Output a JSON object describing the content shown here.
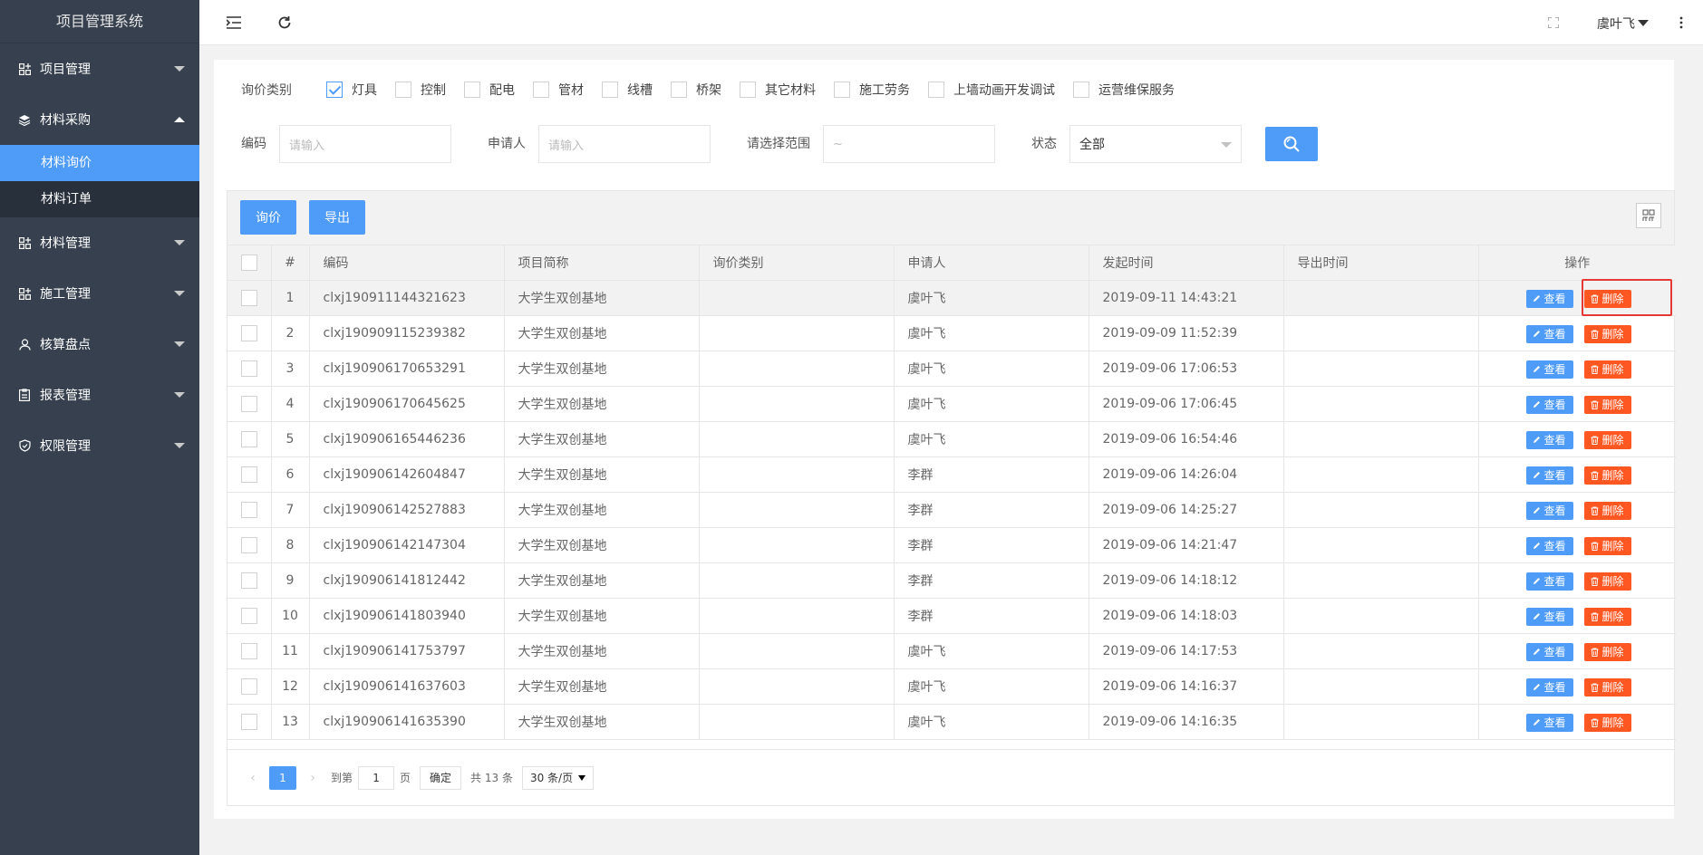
{
  "app": {
    "title": "项目管理系统"
  },
  "sidebar": {
    "items": [
      {
        "label": "项目管理",
        "icon": "grid-plus-icon",
        "expanded": false
      },
      {
        "label": "材料采购",
        "icon": "layers-icon",
        "expanded": true,
        "children": [
          {
            "label": "材料询价",
            "active": true
          },
          {
            "label": "材料订单",
            "active": false
          }
        ]
      },
      {
        "label": "材料管理",
        "icon": "grid-plus-icon",
        "expanded": false
      },
      {
        "label": "施工管理",
        "icon": "grid-plus-icon",
        "expanded": false
      },
      {
        "label": "核算盘点",
        "icon": "user-icon",
        "expanded": false
      },
      {
        "label": "报表管理",
        "icon": "clipboard-icon",
        "expanded": false
      },
      {
        "label": "权限管理",
        "icon": "shield-icon",
        "expanded": false
      }
    ]
  },
  "header": {
    "user": "虞叶飞"
  },
  "filters": {
    "category_label": "询价类别",
    "categories": [
      {
        "label": "灯具",
        "checked": true
      },
      {
        "label": "控制",
        "checked": false
      },
      {
        "label": "配电",
        "checked": false
      },
      {
        "label": "管材",
        "checked": false
      },
      {
        "label": "线槽",
        "checked": false
      },
      {
        "label": "桥架",
        "checked": false
      },
      {
        "label": "其它材料",
        "checked": false
      },
      {
        "label": "施工劳务",
        "checked": false
      },
      {
        "label": "上墙动画开发调试",
        "checked": false
      },
      {
        "label": "运营维保服务",
        "checked": false
      }
    ],
    "code_label": "编码",
    "code_placeholder": "请输入",
    "applicant_label": "申请人",
    "applicant_placeholder": "请输入",
    "range_label": "请选择范围",
    "range_placeholder": "~",
    "status_label": "状态",
    "status_value": "全部"
  },
  "toolbar": {
    "inquiry_label": "询价",
    "export_label": "导出"
  },
  "table": {
    "columns": [
      "#",
      "编码",
      "项目简称",
      "询价类别",
      "申请人",
      "发起时间",
      "导出时间",
      "操作"
    ],
    "view_label": "查看",
    "delete_label": "删除",
    "rows": [
      {
        "num": "1",
        "code": "clxj190911144321623",
        "project": "大学生双创基地",
        "category": "",
        "applicant": "虞叶飞",
        "created": "2019-09-11 14:43:21",
        "exported": ""
      },
      {
        "num": "2",
        "code": "clxj190909115239382",
        "project": "大学生双创基地",
        "category": "",
        "applicant": "虞叶飞",
        "created": "2019-09-09 11:52:39",
        "exported": ""
      },
      {
        "num": "3",
        "code": "clxj190906170653291",
        "project": "大学生双创基地",
        "category": "",
        "applicant": "虞叶飞",
        "created": "2019-09-06 17:06:53",
        "exported": ""
      },
      {
        "num": "4",
        "code": "clxj190906170645625",
        "project": "大学生双创基地",
        "category": "",
        "applicant": "虞叶飞",
        "created": "2019-09-06 17:06:45",
        "exported": ""
      },
      {
        "num": "5",
        "code": "clxj190906165446236",
        "project": "大学生双创基地",
        "category": "",
        "applicant": "虞叶飞",
        "created": "2019-09-06 16:54:46",
        "exported": ""
      },
      {
        "num": "6",
        "code": "clxj190906142604847",
        "project": "大学生双创基地",
        "category": "",
        "applicant": "李群",
        "created": "2019-09-06 14:26:04",
        "exported": ""
      },
      {
        "num": "7",
        "code": "clxj190906142527883",
        "project": "大学生双创基地",
        "category": "",
        "applicant": "李群",
        "created": "2019-09-06 14:25:27",
        "exported": ""
      },
      {
        "num": "8",
        "code": "clxj190906142147304",
        "project": "大学生双创基地",
        "category": "",
        "applicant": "李群",
        "created": "2019-09-06 14:21:47",
        "exported": ""
      },
      {
        "num": "9",
        "code": "clxj190906141812442",
        "project": "大学生双创基地",
        "category": "",
        "applicant": "李群",
        "created": "2019-09-06 14:18:12",
        "exported": ""
      },
      {
        "num": "10",
        "code": "clxj190906141803940",
        "project": "大学生双创基地",
        "category": "",
        "applicant": "李群",
        "created": "2019-09-06 14:18:03",
        "exported": ""
      },
      {
        "num": "11",
        "code": "clxj190906141753797",
        "project": "大学生双创基地",
        "category": "",
        "applicant": "虞叶飞",
        "created": "2019-09-06 14:17:53",
        "exported": ""
      },
      {
        "num": "12",
        "code": "clxj190906141637603",
        "project": "大学生双创基地",
        "category": "",
        "applicant": "虞叶飞",
        "created": "2019-09-06 14:16:37",
        "exported": ""
      },
      {
        "num": "13",
        "code": "clxj190906141635390",
        "project": "大学生双创基地",
        "category": "",
        "applicant": "虞叶飞",
        "created": "2019-09-06 14:16:35",
        "exported": ""
      }
    ]
  },
  "pagination": {
    "current": "1",
    "goto_label": "到第",
    "goto_value": "1",
    "page_unit": "页",
    "confirm_label": "确定",
    "total_label": "共 13 条",
    "page_size": "30 条/页"
  }
}
